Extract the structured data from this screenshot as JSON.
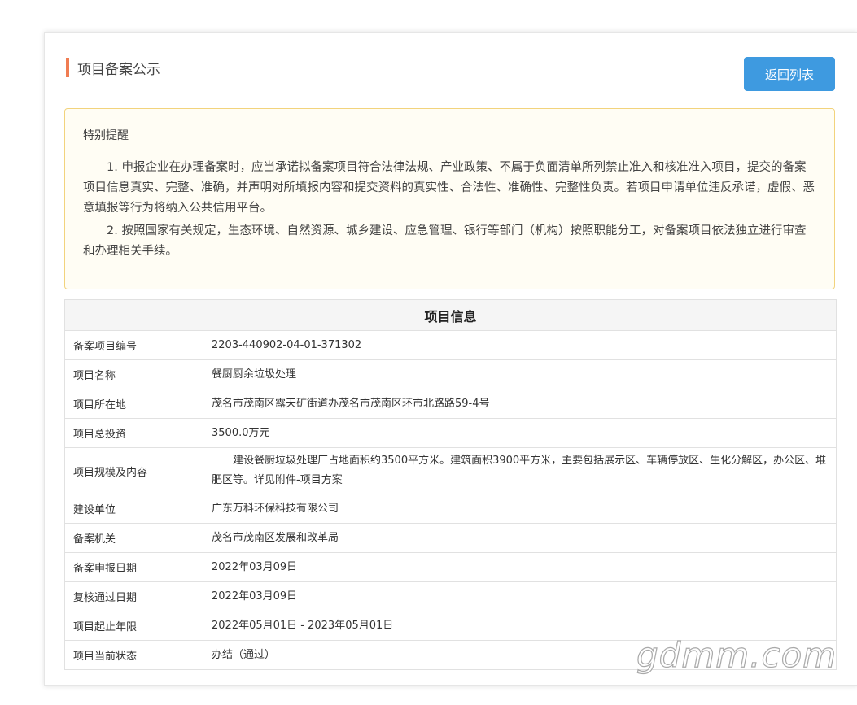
{
  "page": {
    "title": "项目备案公示",
    "back_button": "返回列表"
  },
  "notice": {
    "title": "特别提醒",
    "paragraphs": [
      "1. 申报企业在办理备案时，应当承诺拟备案项目符合法律法规、产业政策、不属于负面清单所列禁止准入和核准准入项目，提交的备案项目信息真实、完整、准确，并声明对所填报内容和提交资料的真实性、合法性、准确性、完整性负责。若项目申请单位违反承诺，虚假、恶意填报等行为将纳入公共信用平台。",
      "2. 按照国家有关规定，生态环境、自然资源、城乡建设、应急管理、银行等部门（机构）按照职能分工，对备案项目依法独立进行审查和办理相关手续。"
    ]
  },
  "table": {
    "header": "项目信息",
    "rows": [
      {
        "label": "备案项目编号",
        "value": "2203-440902-04-01-371302"
      },
      {
        "label": "项目名称",
        "value": "餐厨厨余垃圾处理"
      },
      {
        "label": "项目所在地",
        "value": "茂名市茂南区露天矿街道办茂名市茂南区环市北路路59-4号"
      },
      {
        "label": "项目总投资",
        "value": "3500.0万元"
      },
      {
        "label": "项目规模及内容",
        "value": "建设餐厨垃圾处理厂占地面积约3500平方米。建筑面积3900平方米，主要包括展示区、车辆停放区、生化分解区，办公区、堆肥区等。详见附件-项目方案"
      },
      {
        "label": "建设单位",
        "value": "广东万科环保科技有限公司"
      },
      {
        "label": "备案机关",
        "value": "茂名市茂南区发展和改革局"
      },
      {
        "label": "备案申报日期",
        "value": "2022年03月09日"
      },
      {
        "label": "复核通过日期",
        "value": "2022年03月09日"
      },
      {
        "label": "项目起止年限",
        "value": "2022年05月01日 - 2023年05月01日"
      },
      {
        "label": "项目当前状态",
        "value": "办结（通过）"
      }
    ]
  },
  "watermark": "gdmm.com",
  "colors": {
    "accent_bar": "#f07c52",
    "button": "#3e9ae0",
    "notice_border": "#f2d37c",
    "notice_bg": "#fffdf4"
  }
}
